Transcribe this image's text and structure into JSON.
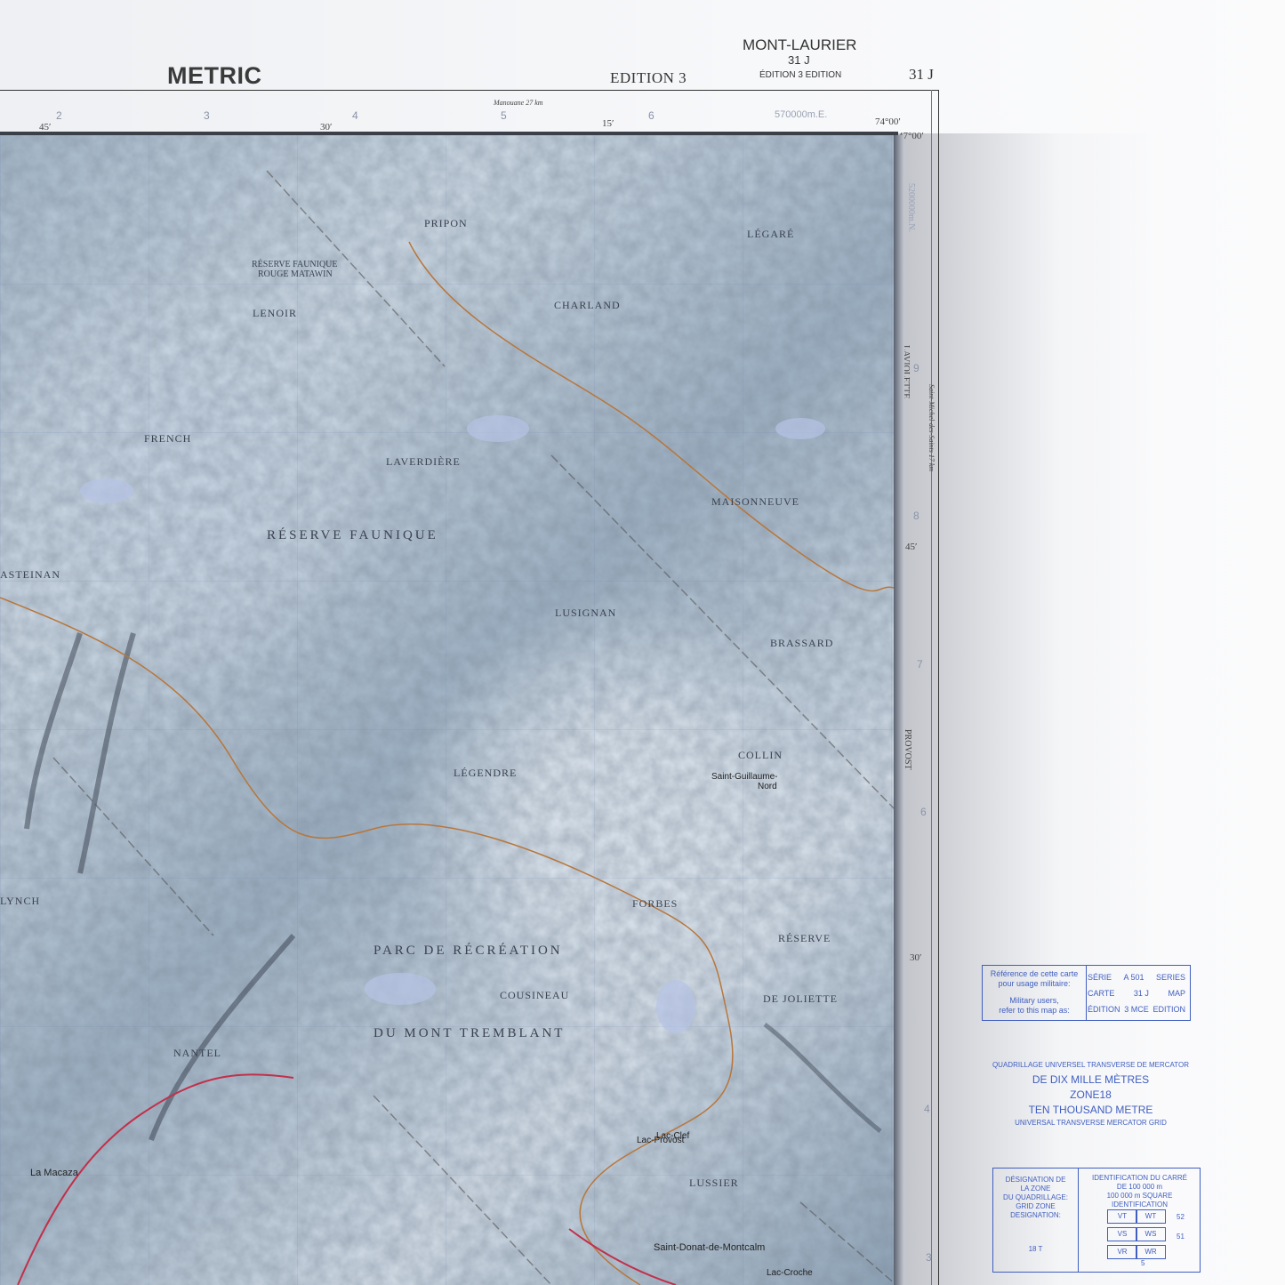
{
  "header": {
    "metric": "METRIC",
    "edition": "EDITION 3",
    "sheet_name": "MONT-LAURIER",
    "sheet_number": "31 J",
    "edition_bilingual": "ÉDITION 3 EDITION",
    "sheet_code": "31 J"
  },
  "top_ticks": {
    "grid": [
      "2",
      "3",
      "4",
      "5",
      "6"
    ],
    "easting": "570000m.E.",
    "longitude": [
      "45′",
      "30′",
      "15′",
      "74°00′"
    ],
    "latitude_top": "47°00′",
    "destination": "Manouane 27 km"
  },
  "right_ticks": {
    "northing": "5200000m.N.",
    "grid": [
      "9",
      "8",
      "7",
      "6",
      "4",
      "3"
    ],
    "latitude": [
      "45′",
      "30′"
    ],
    "township_0": "LAVIOLETTE",
    "township_1": "PROVOST",
    "destination": "Saint-Michel-des-Saints 17 km"
  },
  "places": [
    "PRIPON",
    "LÉGARÉ",
    "RÉSERVE FAUNIQUE",
    "ROUGE MATAWIN",
    "CHARLAND",
    "LENOIR",
    "FRENCH",
    "LAVERDIÈRE",
    "MAISONNEUVE",
    "RÉSERVE FAUNIQUE",
    "ASTEINAN",
    "LUSIGNAN",
    "BRASSARD",
    "LÉGENDRE",
    "COLLIN",
    "Saint-Guillaume-",
    "Nord",
    "LYNCH",
    "FORBES",
    "PARC DE RÉCRÉATION",
    "RÉSERVE",
    "DE JOLIETTE",
    "COUSINEAU",
    "DU MONT TREMBLANT",
    "NANTEL",
    "La Macaza",
    "Lac-Provost",
    "Lac-Clef",
    "LUSSIER",
    "Saint-Donat-de-Montcalm",
    "Lac-Croche"
  ],
  "reference": {
    "fr_line1": "Référence de cette carte",
    "fr_line2": "pour usage militaire:",
    "en_line1": "Military users,",
    "en_line2": "refer to this map as:",
    "rows": [
      {
        "fr": "SÉRIE",
        "value": "A 501",
        "en": "SERIES"
      },
      {
        "fr": "CARTE",
        "value": "31 J",
        "en": "MAP"
      },
      {
        "fr": "ÉDITION",
        "value": "3 MCE",
        "en": "EDITION"
      }
    ]
  },
  "grid_note": {
    "fr_title": "QUADRILLAGE UNIVERSEL TRANSVERSE DE MERCATOR",
    "fr_sub": "DE DIX MILLE MÈTRES",
    "zone": "ZONE18",
    "en_sub": "TEN THOUSAND METRE",
    "en_title": "UNIVERSAL TRANSVERSE MERCATOR GRID"
  },
  "gzd": {
    "fr_1": "DÉSIGNATION DE",
    "fr_2": "LA ZONE",
    "fr_3": "DU QUADRILLAGE:",
    "en": "GRID ZONE DESIGNATION:",
    "value": "18 T"
  },
  "square_id": {
    "fr_1": "IDENTIFICATION DU CARRÉ",
    "fr_2": "DE 100 000 m",
    "en": "100 000 m SQUARE IDENTIFICATION",
    "cells": [
      "VT",
      "WT",
      "VS",
      "WS",
      "VR",
      "WR"
    ],
    "rows": [
      "52",
      "51"
    ],
    "col": "5"
  }
}
